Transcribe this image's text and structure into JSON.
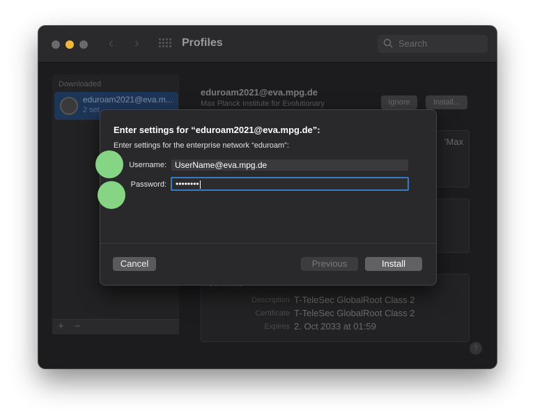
{
  "window": {
    "title": "Profiles",
    "search_placeholder": "Search"
  },
  "sidebar": {
    "section_label": "Downloaded",
    "items": [
      {
        "name": "eduroam2021@eva.m...",
        "sub": "2 set"
      }
    ],
    "add_label": "+",
    "remove_label": "−"
  },
  "profile": {
    "title": "eduroam2021@eva.mpg.de",
    "org": "Max Planck Institute for Evolutionary",
    "ignore_label": "Ignore",
    "install_label": "Install...",
    "description_fragment": "'Max",
    "certificate": {
      "heading": "Certificate",
      "description_key": "Description",
      "description": "T-TeleSec GlobalRoot Class 2",
      "certificate_key": "Certificate",
      "certificate": "T-TeleSec GlobalRoot Class 2",
      "expires_key": "Expires",
      "expires": "2. Oct 2033 at 01:59"
    }
  },
  "help_label": "?",
  "dialog": {
    "title": "Enter settings for “eduroam2021@eva.mpg.de”:",
    "subtitle": "Enter settings for the enterprise network “eduroam”:",
    "username_label": "Username:",
    "username_value": "UserName@eva.mpg.de",
    "password_label": "Password:",
    "password_value": "••••••••",
    "cancel_label": "Cancel",
    "previous_label": "Previous",
    "install_label": "Install"
  },
  "colors": {
    "accent": "#3b7ac6",
    "marker": "#86d585",
    "traffic_yellow": "#f0b73a"
  }
}
